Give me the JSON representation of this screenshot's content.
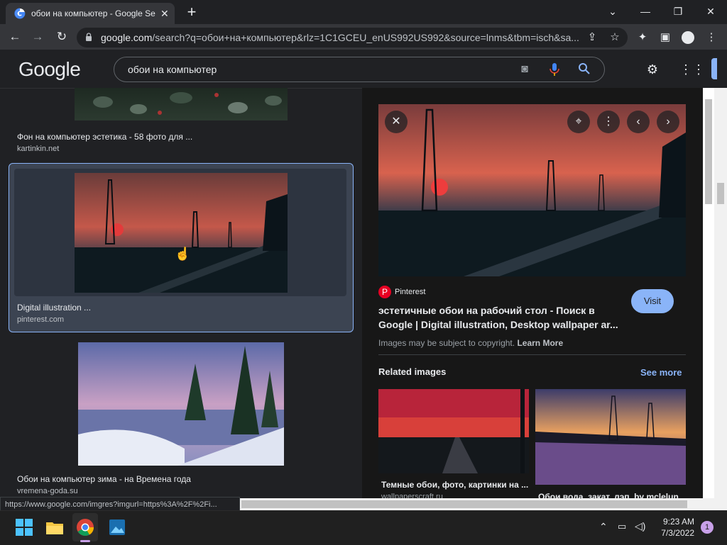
{
  "browser": {
    "tab_title": "обои на компьютер - Google Se",
    "new_tab_label": "+",
    "url_host": "google.com",
    "url_path": "/search?q=обои+на+компьютер&rlz=1C1GCEU_enUS992US992&source=lnms&tbm=isch&sa..."
  },
  "google": {
    "logo": "Google",
    "query": "обои на компьютер"
  },
  "results": [
    {
      "title": "Фон на компьютер эстетика - 58 фото для ...",
      "source": "kartinkin.net"
    },
    {
      "title": "Digital illustration ...",
      "source": "pinterest.com"
    },
    {
      "title": "Обои на компьютер зима - на Времена года",
      "source": "vremena-goda.su"
    }
  ],
  "preview": {
    "source_name": "Pinterest",
    "title_line1": "эстетичные обои на рабочий стол - Поиск в",
    "title_line2": "Google | Digital illustration, Desktop wallpaper ar...",
    "visit_label": "Visit",
    "copyright": "Images may be subject to copyright.",
    "learn_more": "Learn More",
    "related_heading": "Related images",
    "see_more": "See more",
    "related": [
      {
        "title": "Темные обои, фото, картинки на ...",
        "source": "wallpaperscraft.ru"
      },
      {
        "title": "Обои вода, закат, лэп, by mclelun ..."
      }
    ]
  },
  "status_url": "https://www.google.com/imgres?imgurl=https%3A%2F%2Fi...",
  "taskbar": {
    "time": "9:23 AM",
    "date": "7/3/2022",
    "notification_count": "1"
  },
  "colors": {
    "accent": "#8ab4f8",
    "background": "#202124",
    "panel": "#171717"
  }
}
